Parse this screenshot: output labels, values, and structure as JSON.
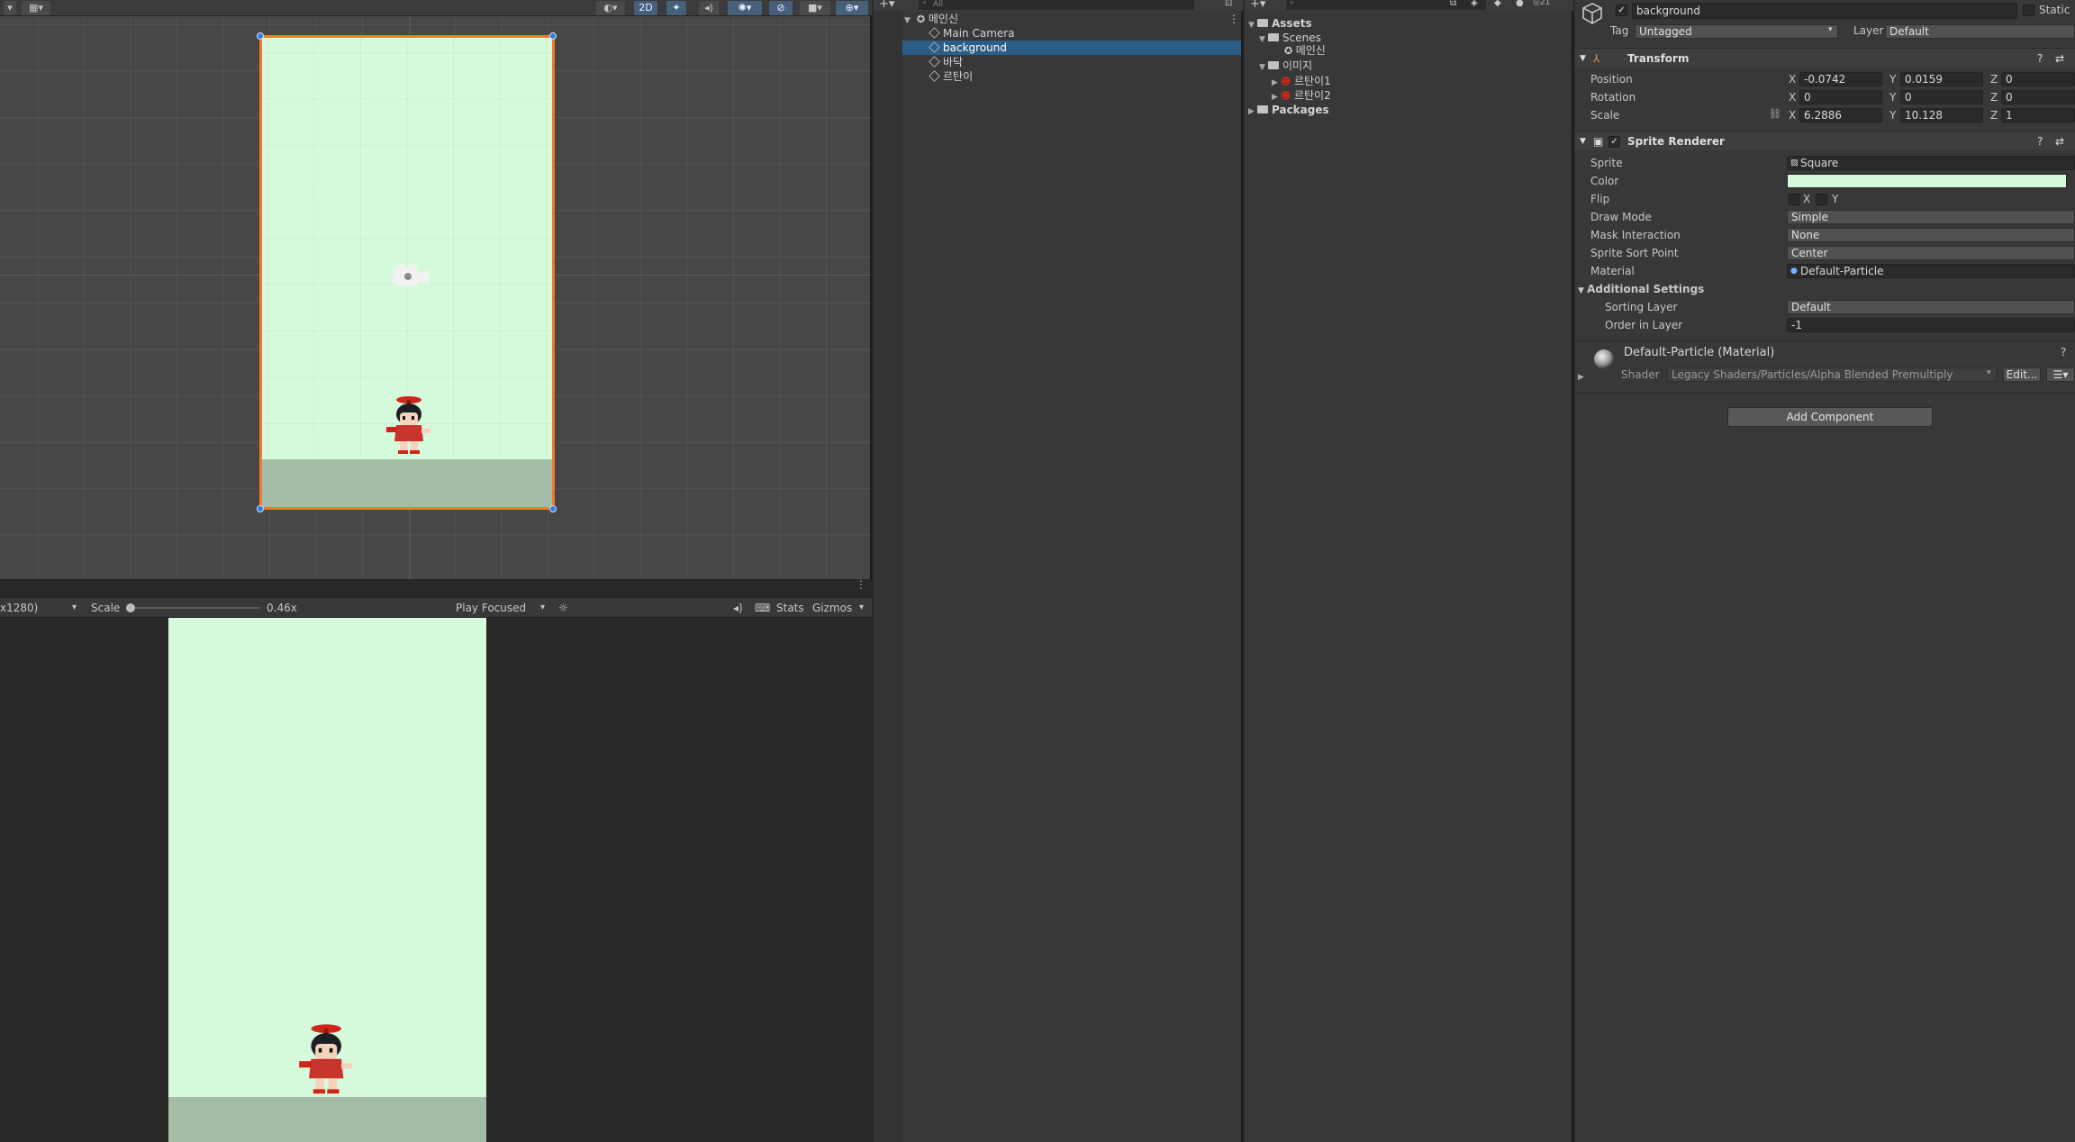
{
  "scene": {
    "toolbar": {
      "mode_2d_label": "2D"
    }
  },
  "game": {
    "resolution_label": "x1280)",
    "scale_label": "Scale",
    "scale_value": 0.46,
    "scale_text": "0.46x",
    "play_mode_label": "Play Focused",
    "stats_label": "Stats",
    "gizmos_label": "Gizmos"
  },
  "hierarchy": {
    "search_placeholder": "All",
    "scene_name": "메인신",
    "items": [
      {
        "label": "Main Camera",
        "selected": false
      },
      {
        "label": "background",
        "selected": true
      },
      {
        "label": "바닥",
        "selected": false
      },
      {
        "label": "르탄이",
        "selected": false
      }
    ]
  },
  "project": {
    "visible_count": "21",
    "assets_label": "Assets",
    "scenes_label": "Scenes",
    "scene_file": "메인신",
    "images_label": "이미지",
    "image_items": [
      "르탄이1",
      "르탄이2"
    ],
    "packages_label": "Packages"
  },
  "inspector": {
    "object_name": "background",
    "static_label": "Static",
    "tag_label": "Tag",
    "tag_value": "Untagged",
    "layer_label": "Layer",
    "layer_value": "Default",
    "transform": {
      "title": "Transform",
      "position_label": "Position",
      "rotation_label": "Rotation",
      "scale_label": "Scale",
      "position": {
        "x": "-0.0742",
        "y": "0.0159",
        "z": "0"
      },
      "rotation": {
        "x": "0",
        "y": "0",
        "z": "0"
      },
      "scale": {
        "x": "6.2886",
        "y": "10.128",
        "z": "1"
      },
      "axis_x": "X",
      "axis_y": "Y",
      "axis_z": "Z"
    },
    "sprite_renderer": {
      "title": "Sprite Renderer",
      "sprite_label": "Sprite",
      "sprite_value": "Square",
      "color_label": "Color",
      "color_value": "#d6fbdc",
      "flip_label": "Flip",
      "flip_x": "X",
      "flip_y": "Y",
      "draw_mode_label": "Draw Mode",
      "draw_mode_value": "Simple",
      "mask_label": "Mask Interaction",
      "mask_value": "None",
      "sort_point_label": "Sprite Sort Point",
      "sort_point_value": "Center",
      "material_label": "Material",
      "material_value": "Default-Particle",
      "additional_label": "Additional Settings",
      "sorting_layer_label": "Sorting Layer",
      "sorting_layer_value": "Default",
      "order_label": "Order in Layer",
      "order_value": "-1"
    },
    "material": {
      "title": "Default-Particle (Material)",
      "shader_label": "Shader",
      "shader_value": "Legacy Shaders/Particles/Alpha Blended Premultiply",
      "edit_label": "Edit..."
    },
    "add_component_label": "Add Component"
  },
  "colors": {
    "background_sprite": "#d6fbdc",
    "floor": "#a3bda6",
    "selection": "#2c5d87",
    "outline": "#f07a2a"
  }
}
